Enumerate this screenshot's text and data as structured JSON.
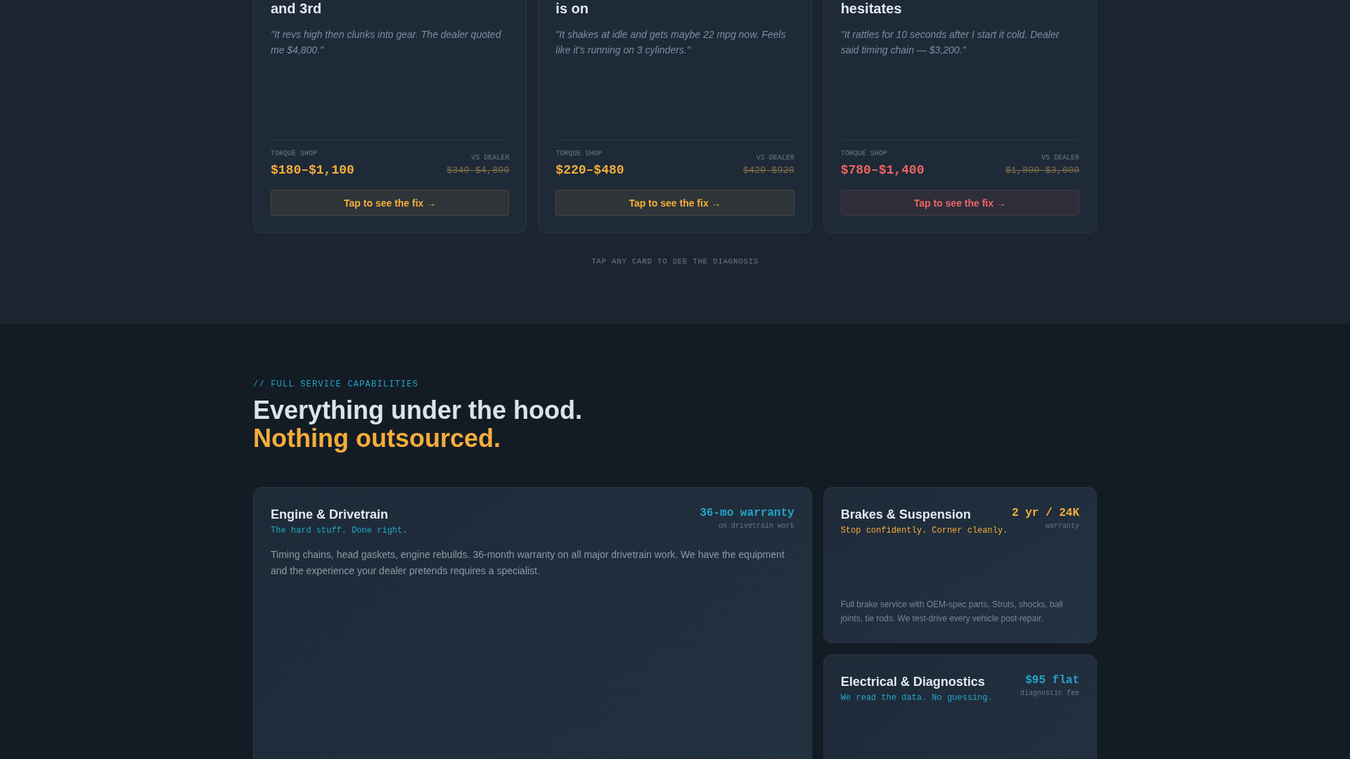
{
  "problem_cards": [
    {
      "title": "and 3rd",
      "quote": "\"It revs high then clunks into gear. The dealer quoted me $4,800.\"",
      "shop_label": "TORQUE SHOP",
      "shop_price": "$180–$1,100",
      "dealer_label": "VS DEALER",
      "dealer_price": "$340–$4,800",
      "button": "Tap to see the fix →",
      "color": "#f5ad3a"
    },
    {
      "title": "is on",
      "quote": "\"It shakes at idle and gets maybe 22 mpg now. Feels like it's running on 3 cylinders.\"",
      "shop_label": "TORQUE SHOP",
      "shop_price": "$220–$480",
      "dealer_label": "VS DEALER",
      "dealer_price": "$420–$920",
      "button": "Tap to see the fix →",
      "color": "#f5ad3a"
    },
    {
      "title": "hesitates",
      "quote": "\"It rattles for 10 seconds after I start it cold. Dealer said timing chain — $3,200.\"",
      "shop_label": "TORQUE SHOP",
      "shop_price": "$780–$1,400",
      "dealer_label": "VS DEALER",
      "dealer_price": "$1,800–$3,600",
      "button": "Tap to see the fix →",
      "color": "#ee6461"
    }
  ],
  "hint": "TAP ANY CARD TO SEE THE DIAGNOSIS",
  "services": {
    "eyebrow": "// FULL SERVICE CAPABILITIES",
    "heading": "Everything under the hood.",
    "heading_accent": "Nothing outsourced.",
    "cards": [
      {
        "kind": "featured",
        "title": "Engine & Drivetrain",
        "tagline": "The hard stuff. Done right.",
        "highlight": "36-mo warranty",
        "highlight_note": "on drivetrain work",
        "description": "Timing chains, head gaskets, engine rebuilds. 36-month warranty on all major drivetrain work. We have the equipment and the experience your dealer pretends requires a specialist.",
        "color": "#22a6c9"
      },
      {
        "kind": "compact",
        "title": "Brakes & Suspension",
        "tagline": "Stop confidently. Corner cleanly.",
        "highlight": "2 yr / 24K",
        "highlight_note": "warranty",
        "description": "Full brake service with OEM-spec parts. Struts, shocks, ball joints, tie rods. We test-drive every vehicle post-repair.",
        "color": "#f5ad3a"
      },
      {
        "kind": "compact",
        "title": "Electrical & Diagnostics",
        "tagline": "We read the data. No guessing.",
        "highlight": "$95 flat",
        "highlight_note": "diagnostic fee",
        "color": "#22a6c9"
      }
    ]
  }
}
